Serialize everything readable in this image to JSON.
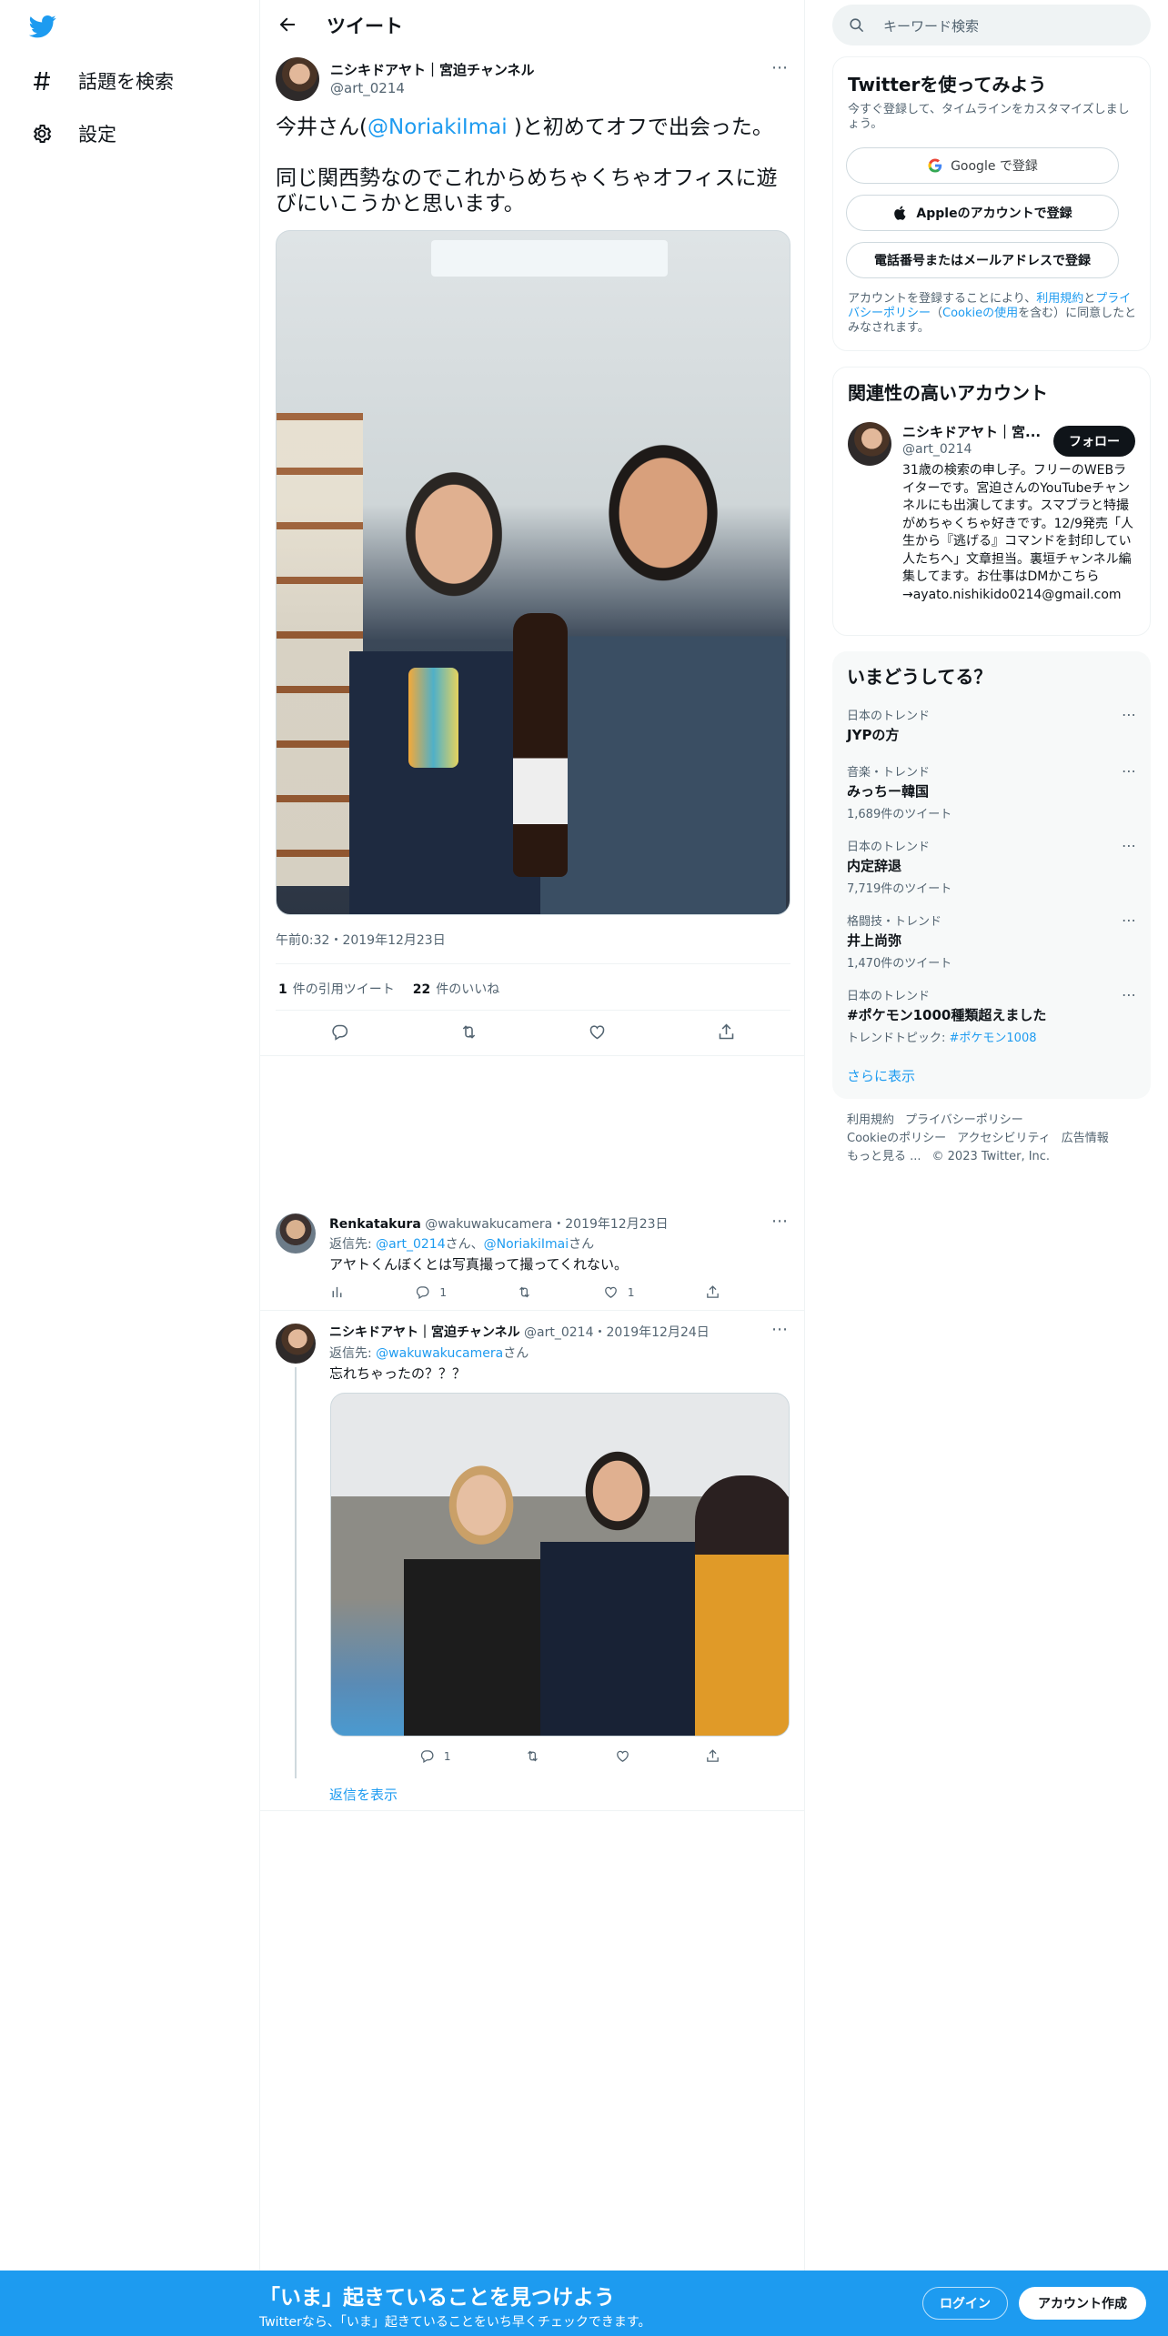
{
  "nav": {
    "explore_label": "話題を検索",
    "settings_label": "設定"
  },
  "header": {
    "title": "ツイート"
  },
  "tweet": {
    "author_name": "ニシキドアヤト｜宮迫チャンネル",
    "author_handle": "@art_0214",
    "text_line1_before": "今井さん(",
    "text_line1_mention": "@NoriakiImai",
    "text_line1_after": " )と初めてオフで出会った。",
    "text_line2": "同じ関西勢なのでこれからめちゃくちゃオフィスに遊びにいこうかと思います。",
    "timestamp": "午前0:32・2019年12月23日",
    "quote_count": "1",
    "quote_label": "件の引用ツイート",
    "like_count": "22",
    "like_label": "件のいいね"
  },
  "replies": [
    {
      "name": "Renkatakura",
      "meta": " @wakuwakucamera・2019年12月23日",
      "reply_to_label": "返信先: ",
      "reply_to_1": "@art_0214",
      "reply_to_suffix_1": "さん、",
      "reply_to_2": "@NoriakiImai",
      "reply_to_suffix_2": "さん",
      "text": "アヤトくんぼくとは写真撮って撮ってくれない。",
      "reply_count": "1",
      "like_count": "1"
    },
    {
      "name": "ニシキドアヤト｜宮迫チャンネル",
      "meta": " @art_0214・2019年12月24日",
      "reply_to_label": "返信先: ",
      "reply_to_1": "@wakuwakucamera",
      "reply_to_suffix_1": "さん",
      "text": "忘れちゃったの？？？",
      "reply_count": "1"
    }
  ],
  "show_replies": "返信を表示",
  "search": {
    "placeholder": "キーワード検索"
  },
  "signup_card": {
    "title": "Twitterを使ってみよう",
    "subtitle": "今すぐ登録して、タイムラインをカスタマイズしましょう。",
    "google": "Google で登録",
    "apple": "Appleのアカウントで登録",
    "phone": "電話番号またはメールアドレスで登録",
    "terms_1": "アカウントを登録することにより、",
    "terms_link_1": "利用規約",
    "terms_2": "と",
    "terms_link_2": "プライバシーポリシー",
    "terms_3": "（",
    "terms_link_3": "Cookieの使用",
    "terms_4": "を含む）に同意したとみなされます。"
  },
  "related_card": {
    "title": "関連性の高いアカウント",
    "name": "ニシキドアヤト｜宮...",
    "handle": "@art_0214",
    "follow": "フォロー",
    "bio": "31歳の検索の申し子。フリーのWEBライターです。宮迫さんのYouTubeチャンネルにも出演してます。スマブラと特撮がめちゃくちゃ好きです。12/9発売「人生から『逃げる』コマンドを封印してい人たちへ」文章担当。裏垣チャンネル編集してます。お仕事はDMかこちら→ayato.nishikido0214@gmail.com"
  },
  "trends_card": {
    "title": "いまどうしてる？",
    "items": [
      {
        "category": "日本のトレンド",
        "name": "JYPの方",
        "count": ""
      },
      {
        "category": "音楽・トレンド",
        "name": "みっちー韓国",
        "count": "1,689件のツイート"
      },
      {
        "category": "日本のトレンド",
        "name": "内定辞退",
        "count": "7,719件のツイート"
      },
      {
        "category": "格闘技・トレンド",
        "name": "井上尚弥",
        "count": "1,470件のツイート"
      },
      {
        "category": "日本のトレンド",
        "name": "#ポケモン1000種類超えました",
        "count": "トレンドトピック: ",
        "count_link": "#ポケモン1008"
      }
    ],
    "show_more": "さらに表示"
  },
  "footer": {
    "links": [
      "利用規約",
      "プライバシーポリシー",
      "Cookieのポリシー",
      "アクセシビリティ",
      "広告情報",
      "もっと見る ..."
    ],
    "copyright": "© 2023 Twitter, Inc."
  },
  "bottom_bar": {
    "title": "「いま」起きていることを見つけよう",
    "subtitle": "Twitterなら、「いま」起きていることをいち早くチェックできます。",
    "login": "ログイン",
    "signup": "アカウント作成"
  },
  "colors": {
    "accent": "#1d9bf0",
    "text": "#0f1419",
    "muted": "#536471"
  }
}
